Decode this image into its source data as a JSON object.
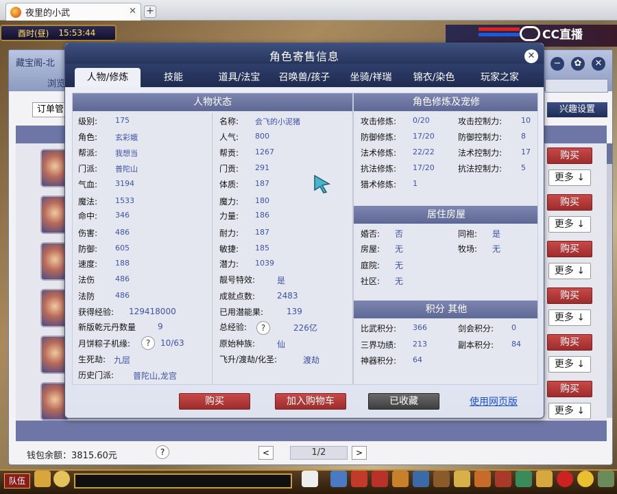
{
  "browser": {
    "tab_title": "夜里的小武",
    "tab_close": "✕",
    "new_tab": "+"
  },
  "game": {
    "time_period": "酉时(昼)",
    "clock": "15:53:44",
    "stream_brand": "CC直播",
    "team_label": "队伍"
  },
  "bg_window": {
    "title": "藏宝阁-北",
    "tab_partial": "浏览",
    "order_select": "订单管",
    "interest_button": "兴趣设置",
    "buy_label": "购买",
    "more_label": "更多 ↓",
    "wallet": "钱包余额：3815.60元",
    "help": "?",
    "prev": "<",
    "next": ">",
    "page": "1/2"
  },
  "modal": {
    "title": "角色寄售信息",
    "close": "✕",
    "tabs": [
      "人物/修炼",
      "技能",
      "道具/法宝",
      "召唤兽/孩子",
      "坐骑/祥瑞",
      "锦衣/染色",
      "玩家之家"
    ],
    "active_tab": 0,
    "sections": {
      "status": "人物状态",
      "cultivation": "角色修炼及宠修",
      "housing": "居住房屋",
      "points": "积分 其他"
    },
    "status_left": [
      {
        "label": "级别:",
        "value": "175"
      },
      {
        "label": "角色:",
        "value": "玄彩娥"
      },
      {
        "label": "帮派:",
        "value": "我想当"
      },
      {
        "label": "门派:",
        "value": "普陀山"
      },
      {
        "label": "气血:",
        "value": "3194"
      },
      {
        "label": "魔法:",
        "value": "1533"
      },
      {
        "label": "命中:",
        "value": "346"
      },
      {
        "label": "伤害:",
        "value": "486"
      },
      {
        "label": "防御:",
        "value": "605"
      },
      {
        "label": "速度:",
        "value": "188"
      },
      {
        "label": "法伤",
        "value": "486"
      },
      {
        "label": "法防",
        "value": "486"
      },
      {
        "label": "获得经验:",
        "value": "129418000"
      },
      {
        "label": "新版乾元丹数量",
        "value": "9"
      },
      {
        "label": "月饼粽子机缘:",
        "value": "10/63"
      },
      {
        "label": "生死劫:",
        "value": "九层"
      },
      {
        "label": "历史门派:",
        "value": "普陀山,龙宫"
      }
    ],
    "status_right": [
      {
        "label": "名称:",
        "value": "会飞的小泥猪"
      },
      {
        "label": "人气:",
        "value": "800"
      },
      {
        "label": "帮贡:",
        "value": "1267"
      },
      {
        "label": "门贡:",
        "value": "291"
      },
      {
        "label": "体质:",
        "value": "187"
      },
      {
        "label": "魔力:",
        "value": "180"
      },
      {
        "label": "力量:",
        "value": "186"
      },
      {
        "label": "耐力:",
        "value": "187"
      },
      {
        "label": "敏捷:",
        "value": "185"
      },
      {
        "label": "潜力:",
        "value": "1039"
      },
      {
        "label": "靓号特效:",
        "value": "是"
      },
      {
        "label": "成就点数:",
        "value": "2483"
      },
      {
        "label": "已用潜能果:",
        "value": "139"
      },
      {
        "label": "总经验:",
        "value": "226亿"
      },
      {
        "label": "原始种族:",
        "value": "仙"
      },
      {
        "label": "飞升/渡劫/化圣:",
        "value": "渡劫"
      }
    ],
    "cultivation": [
      {
        "label": "攻击修炼:",
        "value": "0/20",
        "label2": "攻击控制力:",
        "value2": "10"
      },
      {
        "label": "防御修炼:",
        "value": "17/20",
        "label2": "防御控制力:",
        "value2": "8"
      },
      {
        "label": "法术修炼:",
        "value": "22/22",
        "label2": "法术控制力:",
        "value2": "17"
      },
      {
        "label": "抗法修炼:",
        "value": "17/20",
        "label2": "抗法控制力:",
        "value2": "5"
      },
      {
        "label": "猎术修炼:",
        "value": "1"
      }
    ],
    "housing": [
      {
        "label": "婚否:",
        "value": "否",
        "label2": "同袍:",
        "value2": "是"
      },
      {
        "label": "房屋:",
        "value": "无",
        "label2": "牧场:",
        "value2": "无"
      },
      {
        "label": "庭院:",
        "value": "无"
      },
      {
        "label": "社区:",
        "value": "无"
      }
    ],
    "points": [
      {
        "label": "比武积分:",
        "value": "366",
        "label2": "剑会积分:",
        "value2": "0"
      },
      {
        "label": "三界功绩:",
        "value": "213",
        "label2": "副本积分:",
        "value2": "84"
      },
      {
        "label": "神器积分:",
        "value": "64"
      }
    ],
    "buttons": {
      "buy": "购买",
      "cart": "加入购物车",
      "favorited": "已收藏",
      "web": "使用网页版"
    },
    "qmark": "?"
  },
  "colors": {
    "accent_navy": "#27355c",
    "value_blue": "#3c52a8",
    "buy_red": "#9d2c2c",
    "link_blue": "#1a4fd0"
  }
}
